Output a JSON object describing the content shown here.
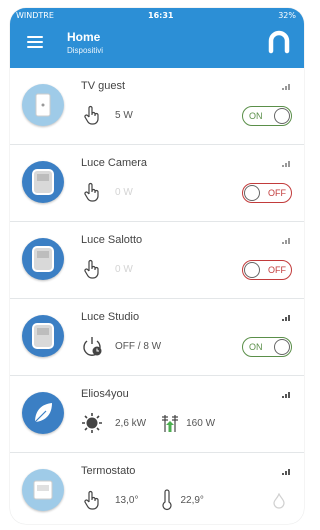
{
  "status": {
    "carrier": "WINDTRE",
    "time": "16:31",
    "battery": "32%"
  },
  "header": {
    "title": "Home",
    "subtitle": "Dispositivi"
  },
  "devices": [
    {
      "name": "TV guest",
      "value": "5 W",
      "toggle": "ON"
    },
    {
      "name": "Luce Camera",
      "value": "0 W",
      "toggle": "OFF"
    },
    {
      "name": "Luce Salotto",
      "value": "0 W",
      "toggle": "OFF"
    },
    {
      "name": "Luce Studio",
      "value": "OFF / 8 W",
      "toggle": "ON"
    },
    {
      "name": "Elios4you",
      "production": "2,6 kW",
      "grid": "160 W"
    },
    {
      "name": "Termostato",
      "current_temp": "13,0°",
      "set_temp": "22,9°"
    }
  ],
  "colors": {
    "header": "#2c8fd6",
    "on": "#5a8f49",
    "off": "#c23b3b",
    "arrow": "#4caf50"
  }
}
